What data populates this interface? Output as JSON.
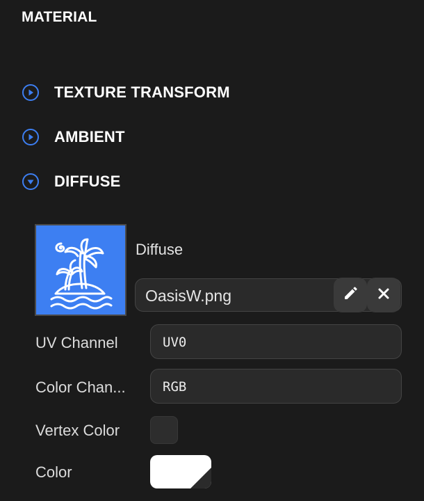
{
  "panel": {
    "title": "MATERIAL"
  },
  "sections": [
    {
      "label": "TEXTURE TRANSFORM",
      "state": "collapsed",
      "icon": "play-circle-icon"
    },
    {
      "label": "AMBIENT",
      "state": "collapsed",
      "icon": "play-circle-icon"
    },
    {
      "label": "DIFFUSE",
      "state": "expanded",
      "icon": "chevron-down-circle-icon"
    }
  ],
  "diffuse": {
    "texture_label": "Diffuse",
    "file_name": "OasisW.png",
    "thumbnail_icon": "island-palm-icon",
    "thumbnail_color": "#3d7ff2",
    "edit_icon": "pencil-icon",
    "clear_icon": "close-icon",
    "uv_channel": {
      "label": "UV Channel",
      "value": "UV0"
    },
    "color_channel": {
      "label": "Color Chan...",
      "value": "RGB"
    },
    "vertex_color": {
      "label": "Vertex Color",
      "checked": false
    },
    "color": {
      "label": "Color",
      "value": "#ffffff"
    }
  },
  "colors": {
    "accent": "#3d7ff2",
    "background": "#1b1b1b",
    "field": "#2a2a2a"
  }
}
